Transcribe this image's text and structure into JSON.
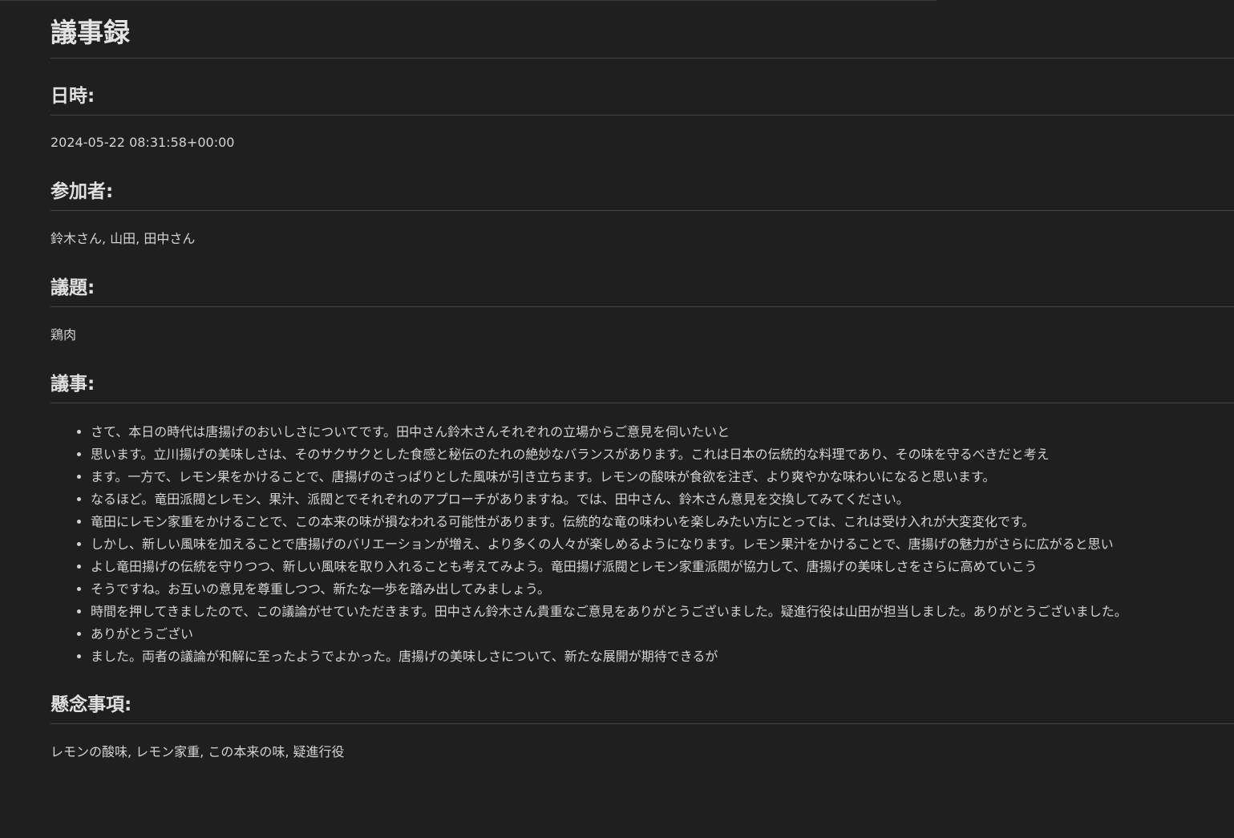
{
  "title": "議事録",
  "date": {
    "heading": "日時:",
    "value": "2024-05-22 08:31:58+00:00"
  },
  "participants": {
    "heading": "参加者:",
    "value": "鈴木さん, 山田, 田中さん"
  },
  "topic": {
    "heading": "議題:",
    "value": "鶏肉"
  },
  "minutes": {
    "heading": "議事:",
    "items": [
      "さて、本日の時代は唐揚げのおいしさについてです。田中さん鈴木さんそれぞれの立場からご意見を伺いたいと",
      "思います。立川揚げの美味しさは、そのサクサクとした食感と秘伝のたれの絶妙なバランスがあります。これは日本の伝統的な料理であり、その味を守るべきだと考え",
      "ます。一方で、レモン果をかけることで、唐揚げのさっぱりとした風味が引き立ちます。レモンの酸味が食欲を注ぎ、より爽やかな味わいになると思います。",
      "なるほど。竜田派閥とレモン、果汁、派閥とでそれぞれのアプローチがありますね。では、田中さん、鈴木さん意見を交換してみてください。",
      "竜田にレモン家重をかけることで、この本来の味が損なわれる可能性があります。伝統的な竜の味わいを楽しみたい方にとっては、これは受け入れが大変変化です。",
      "しかし、新しい風味を加えることで唐揚げのバリエーションが増え、より多くの人々が楽しめるようになります。レモン果汁をかけることで、唐揚げの魅力がさらに広がると思い",
      "よし竜田揚げの伝統を守りつつ、新しい風味を取り入れることも考えてみよう。竜田揚げ派閥とレモン家重派閥が協力して、唐揚げの美味しさをさらに高めていこう",
      "そうですね。お互いの意見を尊重しつつ、新たな一歩を踏み出してみましょう。",
      "時間を押してきましたので、この議論がせていただきます。田中さん鈴木さん貴重なご意見をありがとうございました。疑進行役は山田が担当しました。ありがとうございました。",
      "ありがとうござい",
      "ました。両者の議論が和解に至ったようでよかった。唐揚げの美味しさについて、新たな展開が期待できるが"
    ]
  },
  "concerns": {
    "heading": "懸念事項:",
    "value": "レモンの酸味, レモン家重, この本来の味, 疑進行役"
  }
}
